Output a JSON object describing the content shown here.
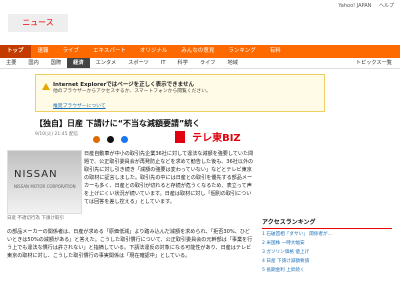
{
  "top_links": [
    "Yahoo! JAPAN",
    "ヘルプ"
  ],
  "logo": "ニュース",
  "nav": [
    {
      "label": "トップ",
      "active": true
    },
    {
      "label": "速報",
      "active": false
    },
    {
      "label": "ライブ",
      "active": false
    },
    {
      "label": "エキスパート",
      "active": false
    },
    {
      "label": "オリジナル",
      "active": false
    },
    {
      "label": "みんなの意見",
      "active": false
    },
    {
      "label": "ランキング",
      "active": false
    },
    {
      "label": "有料",
      "active": false
    }
  ],
  "subnav": [
    {
      "label": "主要",
      "active": false
    },
    {
      "label": "国内",
      "active": false
    },
    {
      "label": "国際",
      "active": false
    },
    {
      "label": "経済",
      "active": true
    },
    {
      "label": "エンタメ",
      "active": false
    },
    {
      "label": "スポーツ",
      "active": false
    },
    {
      "label": "IT",
      "active": false
    },
    {
      "label": "科学",
      "active": false
    },
    {
      "label": "ライフ",
      "active": false
    },
    {
      "label": "地域",
      "active": false
    }
  ],
  "subnav_right": "トピックス一覧",
  "warning": {
    "title": "Internet Explorerではページを正しく表示できません",
    "body": "他のブラウザーからアクセスするか、スマートフォンから閲覧ください。",
    "link": "推奨ブラウザーについて"
  },
  "headline": "【独自】日産 下請けに“不当な減額要請”続く",
  "meta": "9/10(火) 21:45 配信",
  "brand": "テレ東BIZ",
  "photo": {
    "text1": "NISSAN",
    "text2": "NISSAN MOTOR CORPORATION",
    "caption": "日産 不適切行為 下請け取引"
  },
  "body": "日産自動車が中小の取引先企業36社に対して違法な減額を強要していた問題で、公正取引委員会が再発防止などを求めて勧告した後も、36社以外の取引先に対し引き続き「減額の強要は変わっていない」などとテレビ東京の取材に証言しました。取引先の中には日産との取引を優先する部品メーカーも多く、日産との取引が切れると存続が危うくなるため、表立って声を上げにくい状況が続いています。日産は取材に対し「個別の取引については回答を差し控える」としています。",
  "body2": "の部品メーカーの関係者は、日産が求める「原価低減」より踏み込んだ減額を求められ、「拒否30%、ひどいときは50%の減額がある」と答えた。こうした取引慣行について、公正取引委員会の元幹部は「事業を行う上でも違法な慣行は許されない」と指摘している。下請法違反の対象になる可能性があり、日産はテレビ東京の取材に対し、こうした取引慣行の事実関係は「現在確認中」としている。",
  "sidebar": {
    "title": "アクセスランキング",
    "items": [
      "1 石破首相「ダサい」 関係者が…",
      "2 米国株 一時大幅安",
      "3 ガソリン価格 値上げ",
      "4 日産 下請け減額要請",
      "5 長期金利 上昇続く"
    ]
  }
}
